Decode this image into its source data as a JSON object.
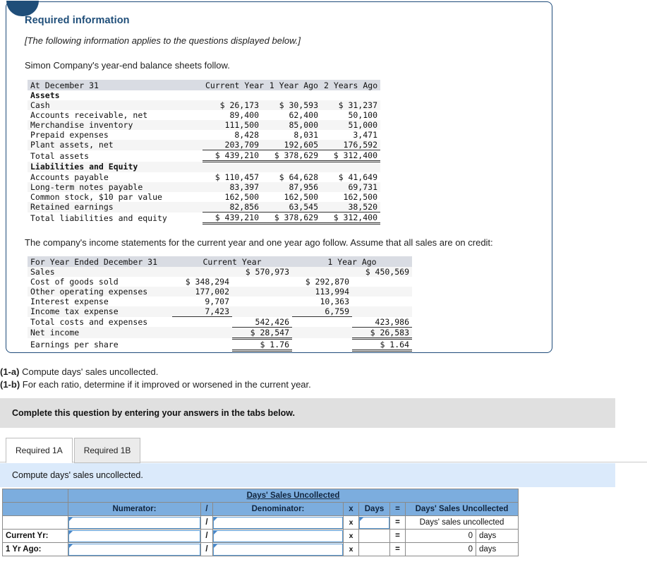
{
  "panel": {
    "title": "Required information",
    "applies_note": "[The following information applies to the questions displayed below.]",
    "balance_intro": "Simon Company's year-end balance sheets follow.",
    "income_intro": "The company's income statements for the current year and one year ago follow. Assume that all sales are on credit:"
  },
  "balance_sheet": {
    "columns": [
      "At December 31",
      "Current Year",
      "1 Year Ago",
      "2 Years Ago"
    ],
    "sections": [
      {
        "heading": "Assets",
        "rows": [
          {
            "label": "Cash",
            "values": [
              "$ 26,173",
              "$ 30,593",
              "$ 31,237"
            ]
          },
          {
            "label": "Accounts receivable, net",
            "values": [
              "89,400",
              "62,400",
              "50,100"
            ]
          },
          {
            "label": "Merchandise inventory",
            "values": [
              "111,500",
              "85,000",
              "51,000"
            ]
          },
          {
            "label": "Prepaid expenses",
            "values": [
              "8,428",
              "8,031",
              "3,471"
            ]
          },
          {
            "label": "Plant assets, net",
            "values": [
              "203,709",
              "192,605",
              "176,592"
            ]
          }
        ],
        "total": {
          "label": "Total assets",
          "values": [
            "$ 439,210",
            "$ 378,629",
            "$ 312,400"
          ]
        }
      },
      {
        "heading": "Liabilities and Equity",
        "rows": [
          {
            "label": "Accounts payable",
            "values": [
              "$ 110,457",
              "$ 64,628",
              "$ 41,649"
            ]
          },
          {
            "label": "Long-term notes payable",
            "values": [
              "83,397",
              "87,956",
              "69,731"
            ]
          },
          {
            "label": "Common stock, $10 par value",
            "values": [
              "162,500",
              "162,500",
              "162,500"
            ]
          },
          {
            "label": "Retained earnings",
            "values": [
              "82,856",
              "63,545",
              "38,520"
            ]
          }
        ],
        "total": {
          "label": "Total liabilities and equity",
          "values": [
            "$ 439,210",
            "$ 378,629",
            "$ 312,400"
          ]
        }
      }
    ]
  },
  "income_statement": {
    "header_label": "For Year Ended December 31",
    "header_current": "Current Year",
    "header_prior": "1 Year Ago",
    "rows": [
      {
        "label": "Sales",
        "cy_detail": "",
        "cy_total": "$ 570,973",
        "pr_detail": "",
        "pr_total": "$ 450,569"
      },
      {
        "label": "Cost of goods sold",
        "cy_detail": "$ 348,294",
        "cy_total": "",
        "pr_detail": "$ 292,870",
        "pr_total": ""
      },
      {
        "label": "Other operating expenses",
        "cy_detail": "177,002",
        "cy_total": "",
        "pr_detail": "113,994",
        "pr_total": ""
      },
      {
        "label": "Interest expense",
        "cy_detail": "9,707",
        "cy_total": "",
        "pr_detail": "10,363",
        "pr_total": ""
      },
      {
        "label": "Income tax expense",
        "cy_detail": "7,423",
        "cy_total": "",
        "pr_detail": "6,759",
        "pr_total": ""
      },
      {
        "label": "Total costs and expenses",
        "cy_detail": "",
        "cy_total": "542,426",
        "pr_detail": "",
        "pr_total": "423,986"
      },
      {
        "label": "Net income",
        "cy_detail": "",
        "cy_total": "$ 28,547",
        "pr_detail": "",
        "pr_total": "$ 26,583"
      },
      {
        "label": "Earnings per share",
        "cy_detail": "",
        "cy_total": "$ 1.76",
        "pr_detail": "",
        "pr_total": "$ 1.64"
      }
    ]
  },
  "prompts": {
    "a_tag": "(1-a)",
    "a_text": "Compute days' sales uncollected.",
    "b_tag": "(1-b)",
    "b_text": "For each ratio, determine if it improved or worsened in the current year."
  },
  "instruction_band": "Complete this question by entering your answers in the tabs below.",
  "tabs": [
    {
      "label": "Required 1A",
      "active": true
    },
    {
      "label": "Required 1B",
      "active": false
    }
  ],
  "sub_instruction": "Compute days' sales uncollected.",
  "answer_table": {
    "title": "Days' Sales Uncollected",
    "headers": {
      "blank": "",
      "numerator": "Numerator:",
      "slash": "/",
      "denominator": "Denominator:",
      "times": "x",
      "days": "Days",
      "equals": "=",
      "result": "Days' Sales Uncollected"
    },
    "rows": [
      {
        "label": "",
        "numerator": "",
        "slash": "/",
        "denominator": "",
        "times": "x",
        "days": "",
        "equals": "=",
        "result": "Days' sales uncollected",
        "unit": ""
      },
      {
        "label": "Current Yr:",
        "numerator": "",
        "slash": "/",
        "denominator": "",
        "times": "x",
        "days": "",
        "equals": "=",
        "result": "0",
        "unit": "days"
      },
      {
        "label": "1 Yr Ago:",
        "numerator": "",
        "slash": "/",
        "denominator": "",
        "times": "x",
        "days": "",
        "equals": "=",
        "result": "0",
        "unit": "days"
      }
    ]
  }
}
